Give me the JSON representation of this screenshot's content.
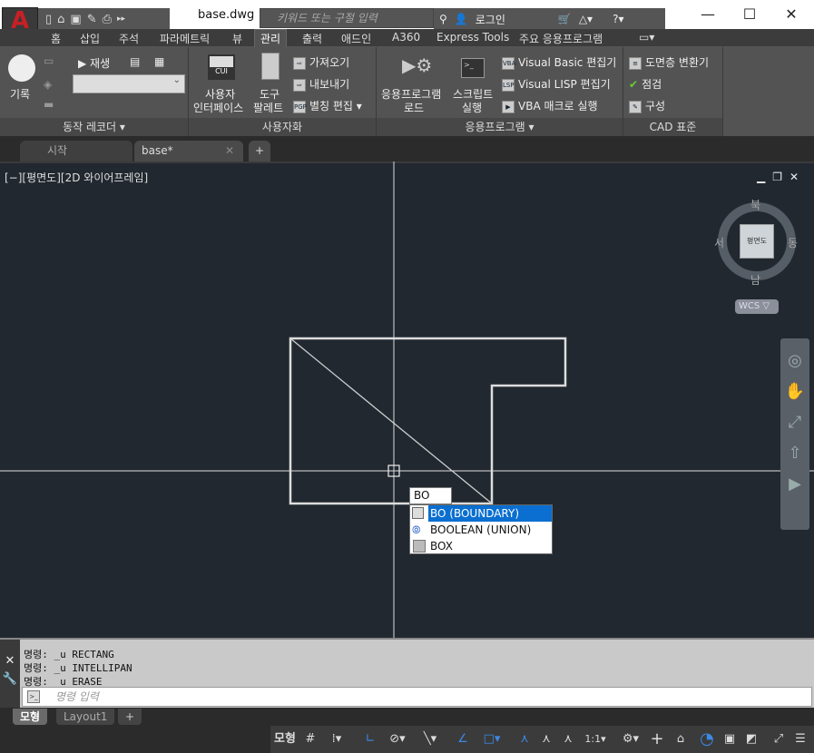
{
  "title_bar": {
    "doc_title": "base.dwg",
    "search_placeholder": "키워드 또는 구절 입력",
    "login": "로그인",
    "app_logo": "A"
  },
  "ribbon_tabs": [
    "홈",
    "삽입",
    "주석",
    "파라메트릭",
    "뷰",
    "관리",
    "출력",
    "애드인",
    "A360",
    "Express Tools",
    "주요 응용프로그램"
  ],
  "active_tab": "관리",
  "panels": {
    "recorder": {
      "label": "동작 레코더",
      "record": "기록",
      "play": "재생"
    },
    "customize": {
      "label": "사용자화",
      "cui_icon": "CUI",
      "ui_line1": "사용자",
      "ui_line2": "인터페이스",
      "tool_line1": "도구",
      "tool_line2": "팔레트",
      "import": "가져오기",
      "export": "내보내기",
      "alias": "별칭 편집"
    },
    "apps": {
      "label": "응용프로그램",
      "load_line1": "응용프로그램",
      "load_line2": "로드",
      "script_line1": "스크립트",
      "script_line2": "실행",
      "vb": "Visual Basic 편집기",
      "lisp": "Visual LISP 편집기",
      "vba": "VBA 매크로 실행"
    },
    "cad": {
      "label": "CAD 표준",
      "layer": "도면층 변환기",
      "check": "점검",
      "config": "구성"
    }
  },
  "file_tabs": [
    "시작",
    "base*"
  ],
  "viewport": {
    "label": "[−][평면도][2D 와이어프레임]",
    "viewcube": {
      "north": "북",
      "south": "남",
      "east": "동",
      "west": "서",
      "face": "평면도",
      "ucs": "WCS"
    }
  },
  "dynamic_input": {
    "value": "BO",
    "suggestions": [
      "BO (BOUNDARY)",
      "BOOLEAN (UNION)",
      "BOX"
    ],
    "selected": 0
  },
  "command": {
    "history": [
      "명령: _u RECTANG",
      "명령: _u INTELLIPAN",
      "명령: _u ERASE"
    ],
    "placeholder": "명령 입력"
  },
  "layout_tabs": [
    "모형",
    "Layout1"
  ],
  "status_bar": {
    "model": "모형",
    "scale": "1:1"
  },
  "colors": {
    "canvas": "#212830",
    "accent": "#0a6fd0",
    "logo": "#c62026"
  }
}
